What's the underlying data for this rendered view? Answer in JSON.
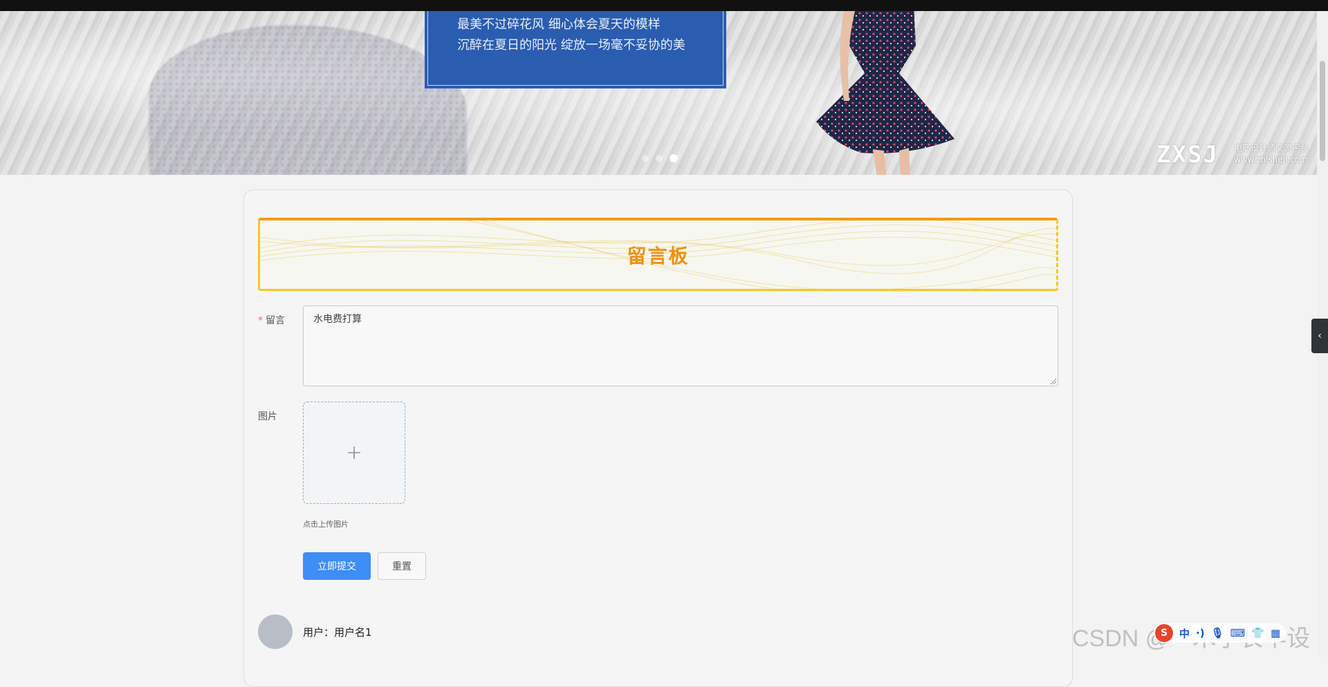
{
  "banner": {
    "line1": "最美不过碎花风 细心体会夏天的模样",
    "line2": "沉醉在夏日的阳光 绽放一场毫不妥协的美",
    "brand_logo": "ZXSJ",
    "brand_text1": "电商设计师交流平台",
    "brand_text2": "www.zhisheji.com",
    "carousel_count": 3,
    "carousel_active": 3
  },
  "board": {
    "title": "留言板"
  },
  "form": {
    "message_label": "留言",
    "message_required": "*",
    "message_value": "水电费打算",
    "image_label": "图片",
    "upload_icon": "plus-icon",
    "upload_tip": "点击上传图片",
    "submit_label": "立即提交",
    "reset_label": "重置"
  },
  "comments": [
    {
      "user": "用户：用户名1"
    }
  ],
  "side_tab_icon": "‹",
  "watermark": "CSDN @一木学长毕设",
  "ime": {
    "logo": "S",
    "items": [
      "中",
      "·)",
      "🎙",
      "⌨",
      "👕",
      "▦"
    ]
  },
  "colors": {
    "accent_orange": "#f0900e",
    "accent_yellow": "#f2c91c",
    "primary_blue": "#3e8ef7",
    "banner_blue": "#2a5cb0"
  }
}
